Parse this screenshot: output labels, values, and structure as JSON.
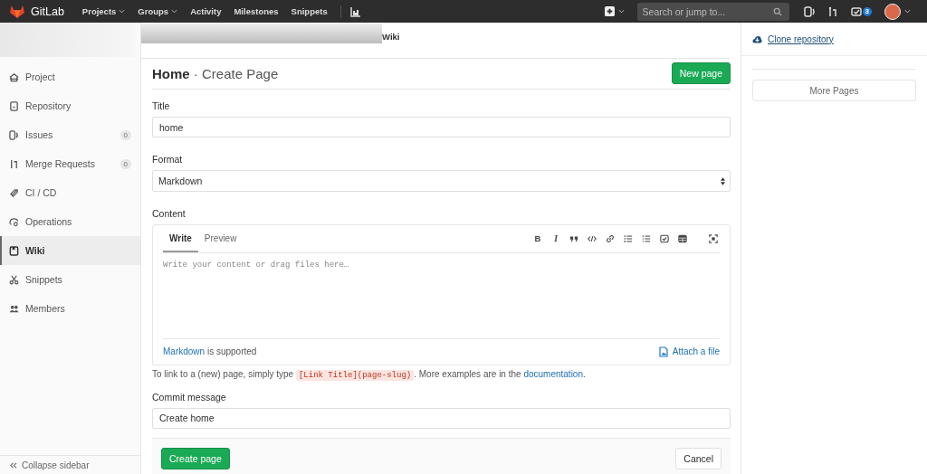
{
  "topbar": {
    "brand": "GitLab",
    "nav": [
      {
        "label": "Projects",
        "dropdown": true
      },
      {
        "label": "Groups",
        "dropdown": true
      },
      {
        "label": "Activity",
        "dropdown": false
      },
      {
        "label": "Milestones",
        "dropdown": false
      },
      {
        "label": "Snippets",
        "dropdown": false
      }
    ],
    "search": {
      "placeholder": "Search or jump to..."
    },
    "todo_count": "3"
  },
  "breadcrumb": {
    "current": "Wiki"
  },
  "sidebar": {
    "items": [
      {
        "label": "Project",
        "selected": false
      },
      {
        "label": "Repository",
        "selected": false
      },
      {
        "label": "Issues",
        "count": "0",
        "selected": false
      },
      {
        "label": "Merge Requests",
        "count": "0",
        "selected": false
      },
      {
        "label": "CI / CD",
        "selected": false
      },
      {
        "label": "Operations",
        "selected": false
      },
      {
        "label": "Wiki",
        "selected": true
      },
      {
        "label": "Snippets",
        "selected": false
      },
      {
        "label": "Members",
        "selected": false
      }
    ],
    "collapse": "Collapse sidebar"
  },
  "page": {
    "title": "Home",
    "separator": "·",
    "subtitle": "Create Page",
    "new_button": "New page"
  },
  "form": {
    "title": {
      "label": "Title",
      "value": "home"
    },
    "format": {
      "label": "Format",
      "value": "Markdown"
    },
    "content": {
      "label": "Content",
      "tabs": [
        {
          "label": "Write",
          "selected": true
        },
        {
          "label": "Preview",
          "selected": false
        }
      ],
      "toolbar": [
        {
          "kind": "bold",
          "glyph": "B"
        },
        {
          "kind": "italic",
          "glyph": "I"
        },
        {
          "kind": "quote"
        },
        {
          "kind": "code"
        },
        {
          "kind": "link"
        },
        {
          "kind": "bullets"
        },
        {
          "kind": "numbers"
        },
        {
          "kind": "task"
        },
        {
          "kind": "table"
        },
        {
          "kind": "fullscreen"
        }
      ],
      "placeholder": "Write your content or drag files here…",
      "markdown_link": "Markdown",
      "supported": "is supported",
      "attach": "Attach a file"
    },
    "help": {
      "before": "To link to a (new) page, simply type",
      "code": "[Link Title](page-slug)",
      "after": ". More examples are in the",
      "link": "documentation",
      "end": "."
    },
    "commit": {
      "label": "Commit message",
      "value": "Create home"
    },
    "submit": "Create page",
    "cancel": "Cancel"
  },
  "right": {
    "clone": "Clone repository",
    "more": "More Pages"
  }
}
